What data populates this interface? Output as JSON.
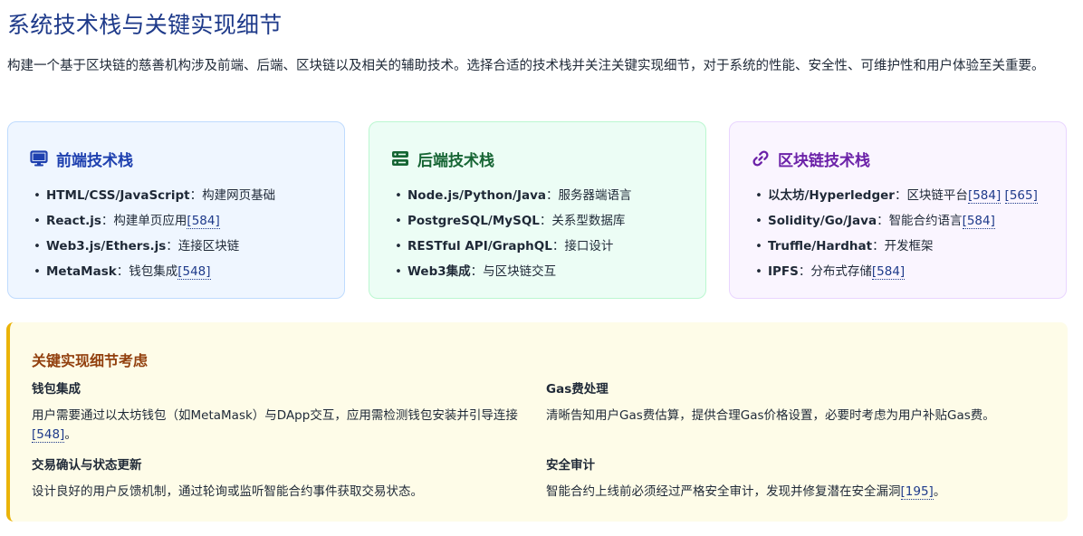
{
  "title": "系统技术栈与关键实现细节",
  "intro": "构建一个基于区块链的慈善机构涉及前端、后端、区块链以及相关的辅助技术。选择合适的技术栈并关注关键实现细节，对于系统的性能、安全性、可维护性和用户体验至关重要。",
  "colors": {
    "frontend_accent": "#1e40af",
    "backend_accent": "#166534",
    "blockchain_accent": "#6b21a8",
    "key_accent": "#eab308",
    "link": "#1e3a8a"
  },
  "frontend": {
    "icon": "monitor-icon",
    "title": "前端技术栈",
    "items": [
      {
        "key": "HTML/CSS/JavaScript",
        "sep": "：",
        "desc": "构建网页基础",
        "refs": []
      },
      {
        "key": "React.js",
        "sep": "：",
        "desc": "构建单页应用",
        "refs": [
          "[584]"
        ]
      },
      {
        "key": "Web3.js/Ethers.js",
        "sep": "：",
        "desc": "连接区块链",
        "refs": []
      },
      {
        "key": "MetaMask",
        "sep": "：",
        "desc": "钱包集成",
        "refs": [
          "[548]"
        ]
      }
    ]
  },
  "backend": {
    "icon": "server-icon",
    "title": "后端技术栈",
    "items": [
      {
        "key": "Node.js/Python/Java",
        "sep": "：",
        "desc": "服务器端语言",
        "refs": []
      },
      {
        "key": "PostgreSQL/MySQL",
        "sep": "：",
        "desc": "关系型数据库",
        "refs": []
      },
      {
        "key": "RESTful API/GraphQL",
        "sep": "：",
        "desc": "接口设计",
        "refs": []
      },
      {
        "key": "Web3集成",
        "sep": "：",
        "desc": "与区块链交互",
        "refs": []
      }
    ]
  },
  "blockchain": {
    "icon": "link-icon",
    "title": "区块链技术栈",
    "items": [
      {
        "key": "以太坊/Hyperledger",
        "sep": "：",
        "desc": "区块链平台",
        "refs": [
          "[584]",
          "[565]"
        ]
      },
      {
        "key": "Solidity/Go/Java",
        "sep": "：",
        "desc": "智能合约语言",
        "refs": [
          "[584]"
        ]
      },
      {
        "key": "Truffle/Hardhat",
        "sep": "：",
        "desc": "开发框架",
        "refs": []
      },
      {
        "key": "IPFS",
        "sep": "：",
        "desc": "分布式存储",
        "refs": [
          "[584]"
        ]
      }
    ]
  },
  "key_details": {
    "title": "关键实现细节考虑",
    "items": [
      {
        "heading": "钱包集成",
        "text": "用户需要通过以太坊钱包（如MetaMask）与DApp交互，应用需检测钱包安装并引导连接",
        "ref": "[548]",
        "tail": "。"
      },
      {
        "heading": "Gas费处理",
        "text": "清晰告知用户Gas费估算，提供合理Gas价格设置，必要时考虑为用户补贴Gas费。",
        "ref": "",
        "tail": ""
      },
      {
        "heading": "交易确认与状态更新",
        "text": "设计良好的用户反馈机制，通过轮询或监听智能合约事件获取交易状态。",
        "ref": "",
        "tail": ""
      },
      {
        "heading": "安全审计",
        "text": "智能合约上线前必须经过严格安全审计，发现并修复潜在安全漏洞",
        "ref": "[195]",
        "tail": "。"
      }
    ]
  }
}
